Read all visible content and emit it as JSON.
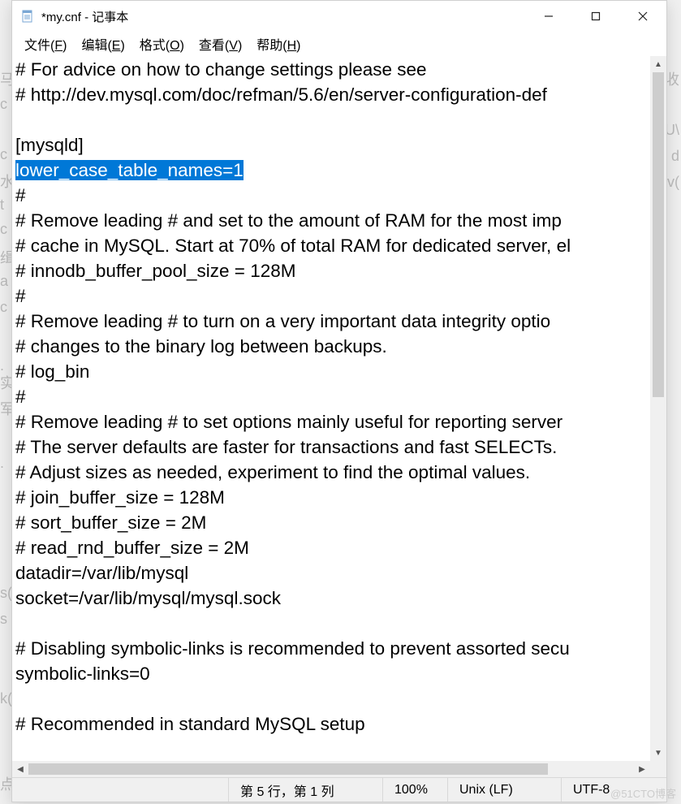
{
  "window": {
    "title": "*my.cnf - 记事本",
    "app_label": "记事本"
  },
  "menu": {
    "file": "文件(F)",
    "edit": "编辑(E)",
    "format": "格式(O)",
    "view": "查看(V)",
    "help": "帮助(H)"
  },
  "content": {
    "lines": [
      {
        "t": "# For advice on how to change settings please see"
      },
      {
        "t": "# http://dev.mysql.com/doc/refman/5.6/en/server-configuration-def"
      },
      {
        "t": ""
      },
      {
        "t": "[mysqld]"
      },
      {
        "t": "lower_case_table_names=1",
        "selected": true
      },
      {
        "t": "#"
      },
      {
        "t": "# Remove leading # and set to the amount of RAM for the most imp"
      },
      {
        "t": "# cache in MySQL. Start at 70% of total RAM for dedicated server, el"
      },
      {
        "t": "# innodb_buffer_pool_size = 128M"
      },
      {
        "t": "#"
      },
      {
        "t": "# Remove leading # to turn on a very important data integrity optio"
      },
      {
        "t": "# changes to the binary log between backups."
      },
      {
        "t": "# log_bin"
      },
      {
        "t": "#"
      },
      {
        "t": "# Remove leading # to set options mainly useful for reporting server"
      },
      {
        "t": "# The server defaults are faster for transactions and fast SELECTs."
      },
      {
        "t": "# Adjust sizes as needed, experiment to find the optimal values."
      },
      {
        "t": "# join_buffer_size = 128M"
      },
      {
        "t": "# sort_buffer_size = 2M"
      },
      {
        "t": "# read_rnd_buffer_size = 2M"
      },
      {
        "t": "datadir=/var/lib/mysql"
      },
      {
        "t": "socket=/var/lib/mysql/mysql.sock"
      },
      {
        "t": ""
      },
      {
        "t": "# Disabling symbolic-links is recommended to prevent assorted secu"
      },
      {
        "t": "symbolic-links=0"
      },
      {
        "t": ""
      },
      {
        "t": "# Recommended in standard MySQL setup"
      }
    ]
  },
  "status": {
    "cursor": "第 5 行，第 1 列",
    "zoom": "100%",
    "line_ending": "Unix (LF)",
    "encoding": "UTF-8"
  },
  "bg_fragments": [
    "马",
    "c",
    "c",
    "水",
    "t",
    "v",
    "c",
    "缉",
    "a",
    "c",
    ".",
    "实",
    "军",
    ".",
    "s(",
    "s",
    "k(",
    "点"
  ],
  "watermark": "@51CTO博客"
}
